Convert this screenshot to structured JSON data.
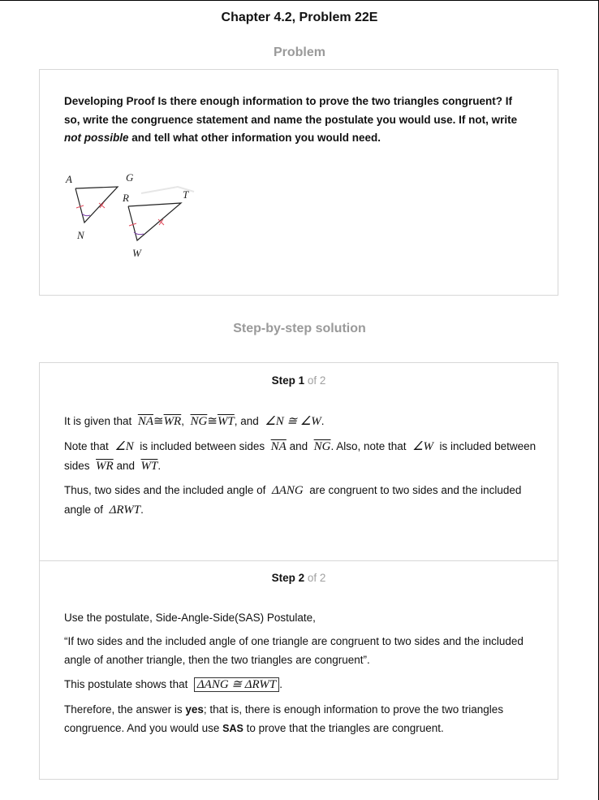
{
  "header": {
    "title": "Chapter 4.2, Problem 22E"
  },
  "problem": {
    "heading": "Problem",
    "text_before_emphasis": "Developing Proof Is there enough information to prove the two triangles congruent? If so, write the congruence statement and name the postulate you would use. If not, write ",
    "emphasis": "not possible",
    "text_after_emphasis": " and tell what other information you would need.",
    "figure_labels": {
      "A": "A",
      "G": "G",
      "N": "N",
      "R": "R",
      "T": "T",
      "W": "W"
    }
  },
  "solution": {
    "heading": "Step-by-step solution",
    "steps": [
      {
        "label": "Step 1",
        "of": "of 2",
        "p1": {
          "t1": "It is given that",
          "s1": "NA",
          "cong": "≅",
          "s2": "WR",
          "comma": ",",
          "s3": "NG",
          "s4": "WT",
          "t2": ", and",
          "a1": "∠N ≅ ∠W",
          "end": "."
        },
        "p2": {
          "t1": "Note that",
          "a1": "∠N",
          "t2": "is included between sides",
          "s1": "NA",
          "and": "and",
          "s2": "NG",
          "t3": ". Also, note that",
          "a2": "∠W",
          "t4": "is included between sides",
          "s3": "WR",
          "s4": "WT",
          "end": "."
        },
        "p3": {
          "t1": "Thus, two sides and the included angle of",
          "tri1": "ΔANG",
          "t2": "are congruent to two sides and the included angle of",
          "tri2": "ΔRWT",
          "end": "."
        }
      },
      {
        "label": "Step 2",
        "of": "of 2",
        "p1": "Use the postulate, Side-Angle-Side(SAS) Postulate,",
        "p2": "“If two sides and the included angle of one triangle are congruent to two sides and the included angle of another triangle, then the two triangles are congruent”.",
        "p3": {
          "t1": "This postulate shows that",
          "answer": "ΔANG ≅ ΔRWT",
          "end": "."
        },
        "p4": {
          "t1": "Therefore, the answer is ",
          "yes": "yes",
          "t2": "; that is, there is enough information to prove the two triangles congruence. And you would use ",
          "sas": "SAS",
          "t3": " to prove that the triangles are congruent."
        }
      }
    ]
  }
}
